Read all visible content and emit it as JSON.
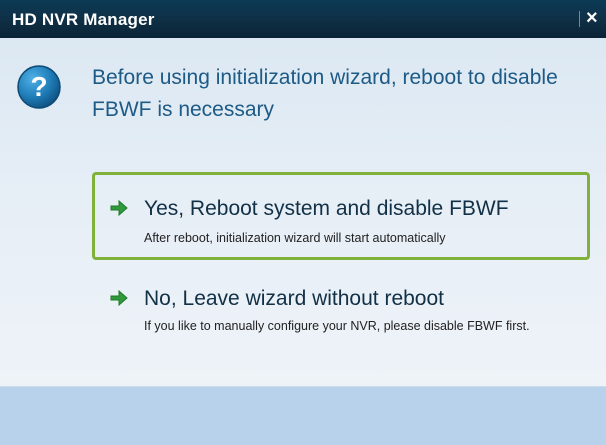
{
  "window": {
    "title": "HD NVR Manager",
    "close_symbol": "×"
  },
  "message": {
    "icon": "question-icon",
    "text": "Before using initialization wizard, reboot to disable FBWF is necessary"
  },
  "options": [
    {
      "label": "Yes, Reboot system and disable FBWF",
      "description": "After reboot, initialization wizard will start automatically",
      "icon": "arrow-right-icon",
      "highlighted": true
    },
    {
      "label": "No, Leave wizard without reboot",
      "description": "If you like to manually configure your NVR, please disable FBWF first.",
      "icon": "arrow-right-icon",
      "highlighted": false
    }
  ],
  "colors": {
    "title_bar": "#0f2f44",
    "message_text": "#1d5a86",
    "highlight_border": "#7fb13b",
    "arrow": "#2f9a3b",
    "question_icon": "#1e7bb6",
    "footer": "#b7d2ea"
  }
}
